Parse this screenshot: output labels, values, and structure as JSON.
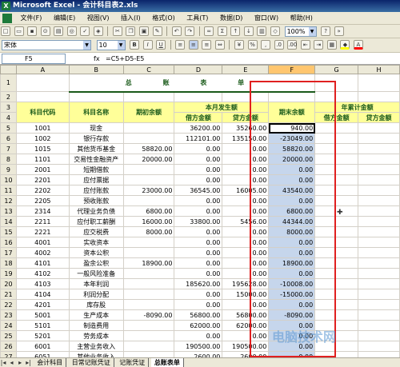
{
  "window": {
    "title": "Microsoft Excel - 会计科目表2.xls"
  },
  "menu": [
    "文件(F)",
    "编辑(E)",
    "视图(V)",
    "插入(I)",
    "格式(O)",
    "工具(T)",
    "数据(D)",
    "窗口(W)",
    "帮助(H)"
  ],
  "toolbar": {
    "zoom": "100%",
    "font": "宋体",
    "size": "10"
  },
  "formula": {
    "cell": "F5",
    "fx": "fx",
    "value": "=C5+D5-E5"
  },
  "sheet": {
    "columns": [
      "A",
      "B",
      "C",
      "D",
      "E",
      "F",
      "G",
      "H"
    ],
    "title": "总 账 表 单",
    "headers": {
      "code": "科目代码",
      "name": "科目名称",
      "begin": "期初余额",
      "period": "本月发生额",
      "debit": "借方金额",
      "credit": "贷方金额",
      "end": "期末余额",
      "cum": "年累计金额",
      "cum_debit": "借方金额",
      "cum_credit": "贷方金额"
    },
    "rows": [
      {
        "n": "5",
        "code": "1001",
        "name": "现金",
        "begin": "",
        "debit": "36200.00",
        "credit": "35260.00",
        "end": "940.00"
      },
      {
        "n": "6",
        "code": "1002",
        "name": "银行存款",
        "begin": "",
        "debit": "112101.00",
        "credit": "135150.00",
        "end": "-23049.00"
      },
      {
        "n": "7",
        "code": "1015",
        "name": "其他货币基金",
        "begin": "58820.00",
        "debit": "0.00",
        "credit": "0.00",
        "end": "58820.00"
      },
      {
        "n": "8",
        "code": "1101",
        "name": "交易性金融资产",
        "begin": "20000.00",
        "debit": "0.00",
        "credit": "0.00",
        "end": "20000.00"
      },
      {
        "n": "9",
        "code": "2001",
        "name": "短期借款",
        "begin": "",
        "debit": "0.00",
        "credit": "0.00",
        "end": "0.00"
      },
      {
        "n": "10",
        "code": "2201",
        "name": "应付票据",
        "begin": "",
        "debit": "0.00",
        "credit": "0.00",
        "end": "0.00"
      },
      {
        "n": "11",
        "code": "2202",
        "name": "应付账款",
        "begin": "23000.00",
        "debit": "36545.00",
        "credit": "16005.00",
        "end": "43540.00"
      },
      {
        "n": "12",
        "code": "2205",
        "name": "预收账款",
        "begin": "",
        "debit": "0.00",
        "credit": "0.00",
        "end": "0.00"
      },
      {
        "n": "13",
        "code": "2314",
        "name": "代理业务负债",
        "begin": "6800.00",
        "debit": "0.00",
        "credit": "0.00",
        "end": "6800.00"
      },
      {
        "n": "14",
        "code": "2211",
        "name": "应付职工薪酬",
        "begin": "16000.00",
        "debit": "33800.00",
        "credit": "5456.00",
        "end": "44344.00"
      },
      {
        "n": "15",
        "code": "2221",
        "name": "应交税费",
        "begin": "8000.00",
        "debit": "0.00",
        "credit": "0.00",
        "end": "8000.00"
      },
      {
        "n": "16",
        "code": "4001",
        "name": "实收资本",
        "begin": "",
        "debit": "0.00",
        "credit": "0.00",
        "end": "0.00"
      },
      {
        "n": "17",
        "code": "4002",
        "name": "资本公积",
        "begin": "",
        "debit": "0.00",
        "credit": "0.00",
        "end": "0.00"
      },
      {
        "n": "18",
        "code": "4101",
        "name": "盈余公积",
        "begin": "18900.00",
        "debit": "0.00",
        "credit": "0.00",
        "end": "18900.00"
      },
      {
        "n": "19",
        "code": "4102",
        "name": "一般风险准备",
        "begin": "",
        "debit": "0.00",
        "credit": "0.00",
        "end": "0.00"
      },
      {
        "n": "20",
        "code": "4103",
        "name": "本年利润",
        "begin": "",
        "debit": "185620.00",
        "credit": "195628.00",
        "end": "-10008.00"
      },
      {
        "n": "21",
        "code": "4104",
        "name": "利润分配",
        "begin": "",
        "debit": "0.00",
        "credit": "15000.00",
        "end": "-15000.00"
      },
      {
        "n": "22",
        "code": "4201",
        "name": "库存股",
        "begin": "",
        "debit": "0.00",
        "credit": "0.00",
        "end": "0.00"
      },
      {
        "n": "23",
        "code": "5001",
        "name": "生产成本",
        "begin": "-8090.00",
        "debit": "56800.00",
        "credit": "56800.00",
        "end": "-8090.00"
      },
      {
        "n": "24",
        "code": "5101",
        "name": "制造费用",
        "begin": "",
        "debit": "62000.00",
        "credit": "62000.00",
        "end": "0.00"
      },
      {
        "n": "25",
        "code": "5201",
        "name": "劳务成本",
        "begin": "",
        "debit": "0.00",
        "credit": "0.00",
        "end": "0.00"
      },
      {
        "n": "26",
        "code": "6001",
        "name": "主营业务收入",
        "begin": "",
        "debit": "190500.00",
        "credit": "190500.00",
        "end": "0.00"
      },
      {
        "n": "27",
        "code": "6051",
        "name": "其他业务收入",
        "begin": "",
        "debit": "2600.00",
        "credit": "2600.00",
        "end": "0.00"
      }
    ]
  },
  "tabs": [
    "会计科目",
    "日常记账凭证",
    "记账凭证",
    "总账表单"
  ],
  "watermark": "电脑技术网"
}
